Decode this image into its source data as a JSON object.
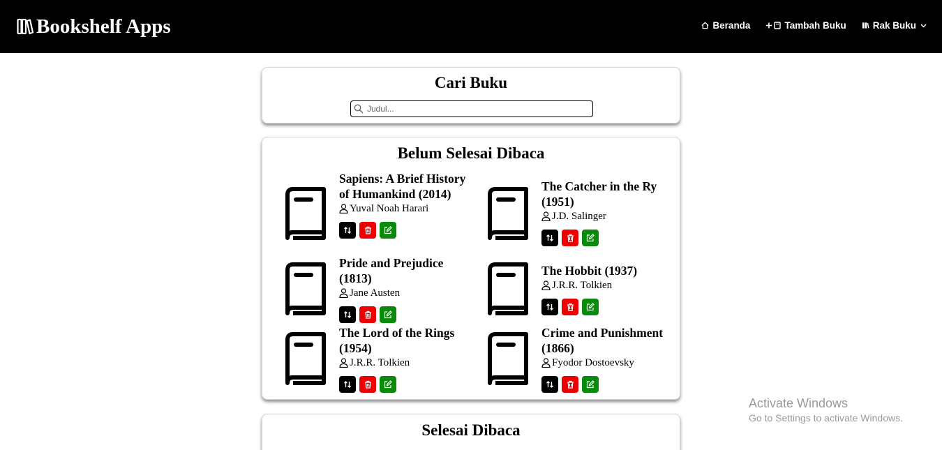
{
  "app": {
    "title": "Bookshelf Apps"
  },
  "nav": {
    "items": [
      {
        "label": "Beranda",
        "icon": "home-icon"
      },
      {
        "label": "Tambah Buku",
        "icon": "plus-book-icon"
      },
      {
        "label": "Rak Buku",
        "icon": "books-icon"
      }
    ]
  },
  "search": {
    "title": "Cari Buku",
    "placeholder": "Judul..."
  },
  "unread": {
    "title": "Belum Selesai Dibaca",
    "books": [
      {
        "title": "Sapiens: A Brief History of Humankind (2014)",
        "author": "Yuval Noah Harari"
      },
      {
        "title": "The Catcher in the Ry (1951)",
        "author": "J.D. Salinger"
      },
      {
        "title": "Pride and Prejudice (1813)",
        "author": "Jane Austen"
      },
      {
        "title": "The Hobbit (1937)",
        "author": "J.R.R. Tolkien"
      },
      {
        "title": "The Lord of the Rings (1954)",
        "author": "J.R.R. Tolkien"
      },
      {
        "title": "Crime and Punishment (1866)",
        "author": "Fyodor Dostoevsky"
      }
    ]
  },
  "done": {
    "title": "Selesai Dibaca"
  },
  "watermark": {
    "title": "Activate Windows",
    "subtitle": "Go to Settings to activate Windows."
  },
  "colors": {
    "header_bg": "#000000",
    "delete": "#ee0000",
    "edit": "#0a8a0a",
    "move": "#000000"
  }
}
